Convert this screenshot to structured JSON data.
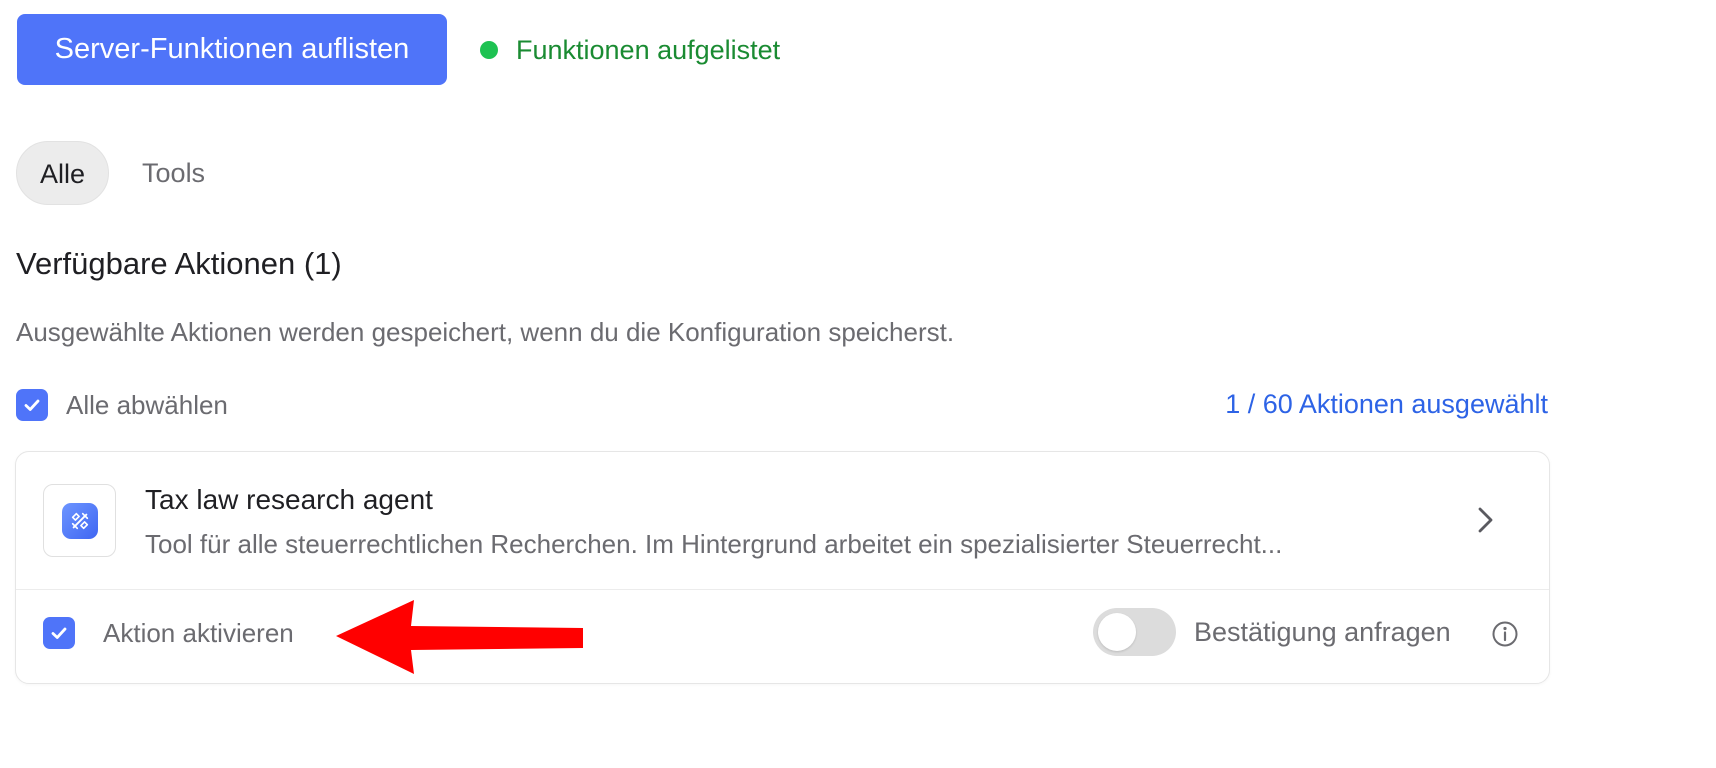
{
  "header": {
    "list_button_label": "Server-Funktionen auflisten",
    "status_text": "Funktionen aufgelistet",
    "status_color": "#1ec252"
  },
  "tabs": [
    {
      "label": "Alle",
      "active": true
    },
    {
      "label": "Tools",
      "active": false
    }
  ],
  "section": {
    "title": "Verfügbare Aktionen (1)",
    "description": "Ausgewählte Aktionen werden gespeichert, wenn du die Konfiguration speicherst."
  },
  "selection": {
    "select_all_label": "Alle abwählen",
    "select_all_checked": true,
    "count_text": "1 / 60 Aktionen ausgewählt"
  },
  "action_card": {
    "icon": "tool-icon",
    "name": "Tax law research agent",
    "description": "Tool für alle steuerrechtlichen Recherchen. Im Hintergrund arbeitet ein spezialisierter Steuerrecht...",
    "enable_label": "Aktion aktivieren",
    "enabled": true,
    "confirm_label": "Bestätigung anfragen",
    "confirm_enabled": false
  },
  "annotation": {
    "arrow_color": "#ff0000"
  },
  "colors": {
    "accent": "#4f74f9",
    "link": "#2d63e6",
    "status_text": "#1a8b32"
  }
}
